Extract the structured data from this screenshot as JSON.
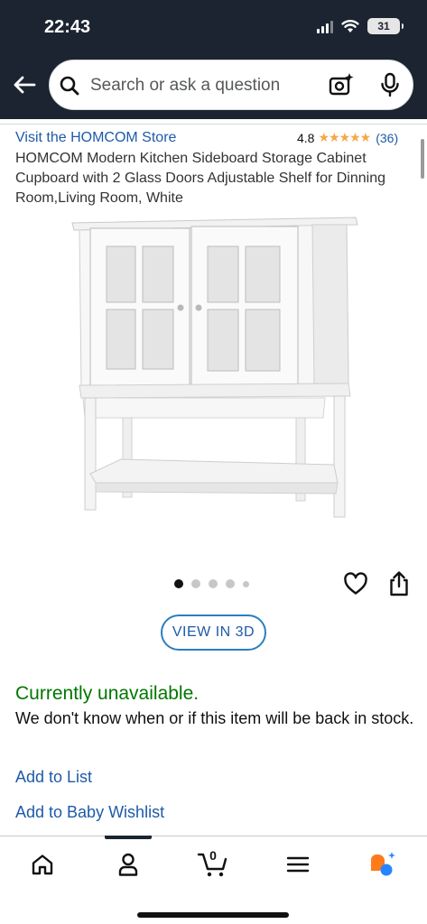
{
  "status_bar": {
    "time": "22:43",
    "battery": "31"
  },
  "search": {
    "placeholder": "Search or ask a question"
  },
  "product": {
    "store_link": "Visit the HOMCOM Store",
    "rating": "4.8",
    "stars": "★★★★★",
    "rating_count": "(36)",
    "title": "HOMCOM Modern Kitchen Sideboard Storage Cabinet Cupboard with 2 Glass Doors Adjustable Shelf for Dinning Room,Living Room, White",
    "image_count": 5,
    "active_image_index": 0
  },
  "actions": {
    "view_3d": "VIEW IN 3D"
  },
  "availability": {
    "status": "Currently unavailable.",
    "message": "We don't know when or if this item will be back in stock."
  },
  "links": {
    "add_to_list": "Add to List",
    "add_to_baby_wishlist": "Add to Baby Wishlist"
  },
  "bottom_nav": {
    "items": [
      "home-icon",
      "account-icon",
      "cart-icon",
      "menu-icon",
      "rufus-icon"
    ],
    "cart_count": "0",
    "active_item": "account-icon"
  },
  "colors": {
    "header_bg": "#1b2430",
    "link": "#1e5aa8",
    "unavailable": "#007600",
    "stars": "#f3a847"
  }
}
